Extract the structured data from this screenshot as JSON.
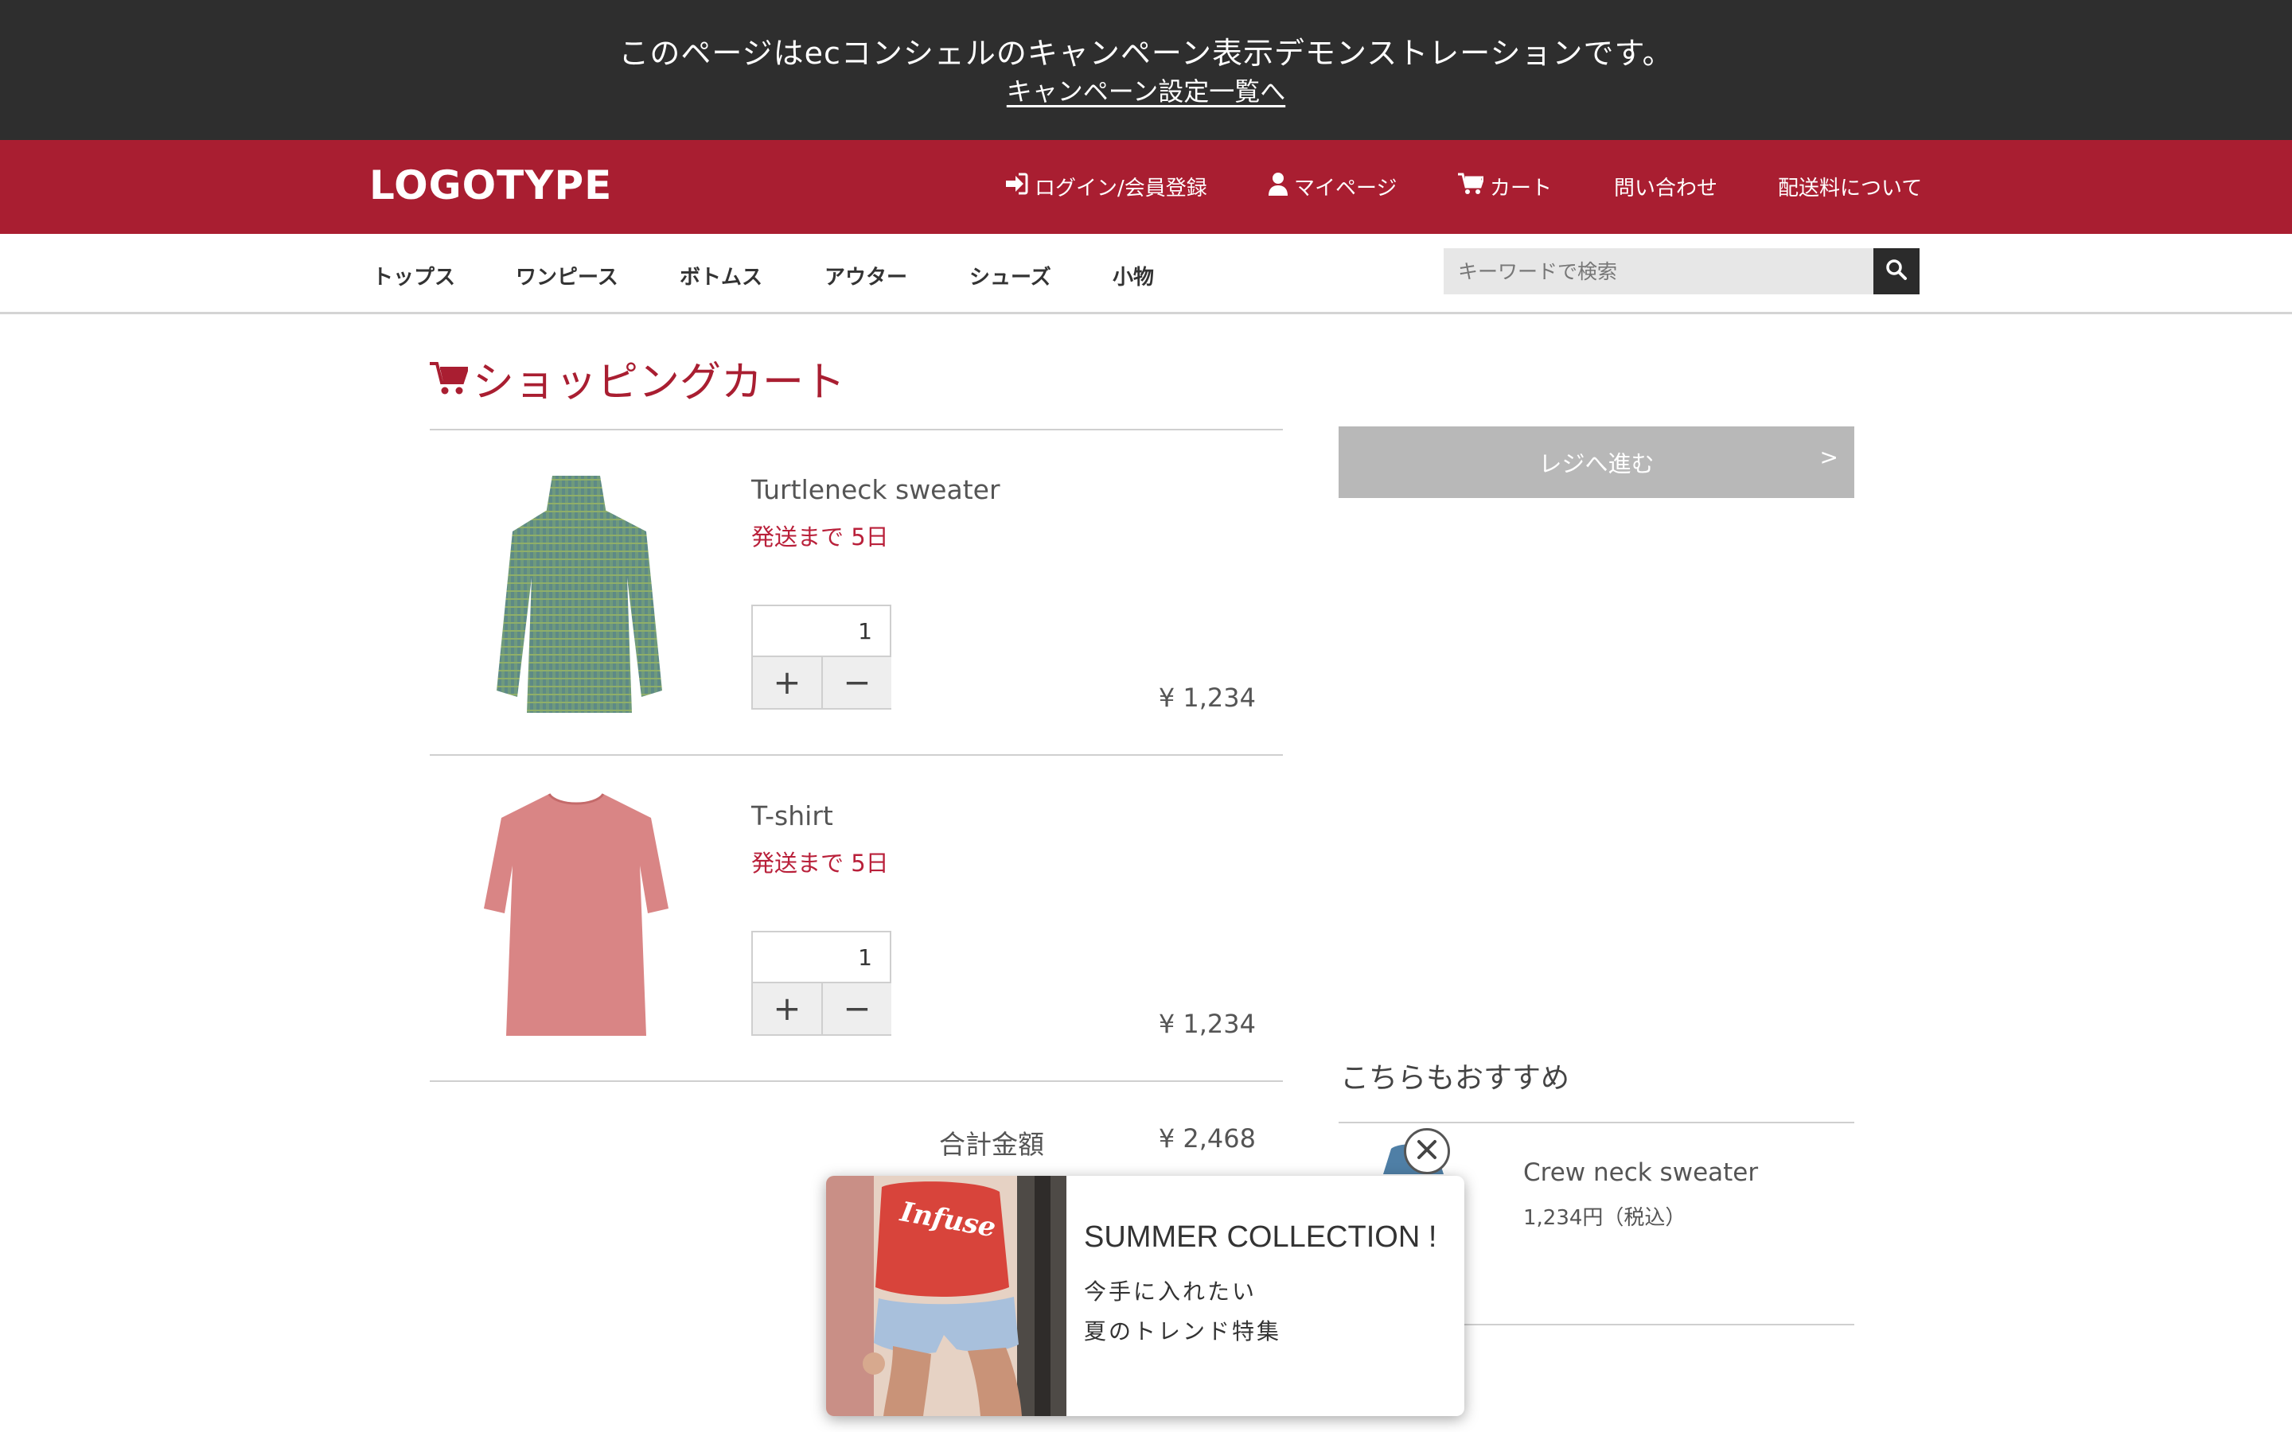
{
  "top_banner": {
    "message": "このページはecコンシェルのキャンペーン表示デモンストレーションです。",
    "link": "キャンペーン設定一覧へ"
  },
  "header": {
    "logo": "LOGOTYPE",
    "nav": [
      {
        "label": "ログイン/会員登録",
        "icon": "sign-in-icon"
      },
      {
        "label": "マイページ",
        "icon": "user-icon"
      },
      {
        "label": "カート",
        "icon": "cart-icon"
      },
      {
        "label": "問い合わせ"
      },
      {
        "label": "配送料について"
      }
    ]
  },
  "categories": [
    "トップス",
    "ワンピース",
    "ボトムス",
    "アウター",
    "シューズ",
    "小物"
  ],
  "search": {
    "placeholder": "キーワードで検索",
    "icon": "search-icon"
  },
  "cart": {
    "title": "ショッピングカート",
    "items": [
      {
        "name": "Turtleneck sweater",
        "shipping": "発送まで 5日",
        "quantity": "1",
        "plus": "+",
        "minus": "−",
        "price": "¥ 1,234"
      },
      {
        "name": "T-shirt",
        "shipping": "発送まで 5日",
        "quantity": "1",
        "plus": "+",
        "minus": "−",
        "price": "¥ 1,234"
      }
    ],
    "total_label": "合計金額",
    "total_value": "¥ 2,468"
  },
  "checkout": {
    "label": "レジへ進む",
    "arrow": ">"
  },
  "recommend": {
    "title": "こちらもおすすめ",
    "items": [
      {
        "name": "Crew neck sweater",
        "price": "1,234円（税込）"
      }
    ]
  },
  "popup": {
    "title": "SUMMER COLLECTION !",
    "line1": "今手に入れたい",
    "line2": "夏のトレンド特集",
    "shirt_text": "Infuse"
  },
  "colors": {
    "brand": "#a91e31",
    "accent_text": "#b9203a",
    "banner_bg": "#2e2e2e",
    "button_disabled": "#b8b8b8"
  }
}
